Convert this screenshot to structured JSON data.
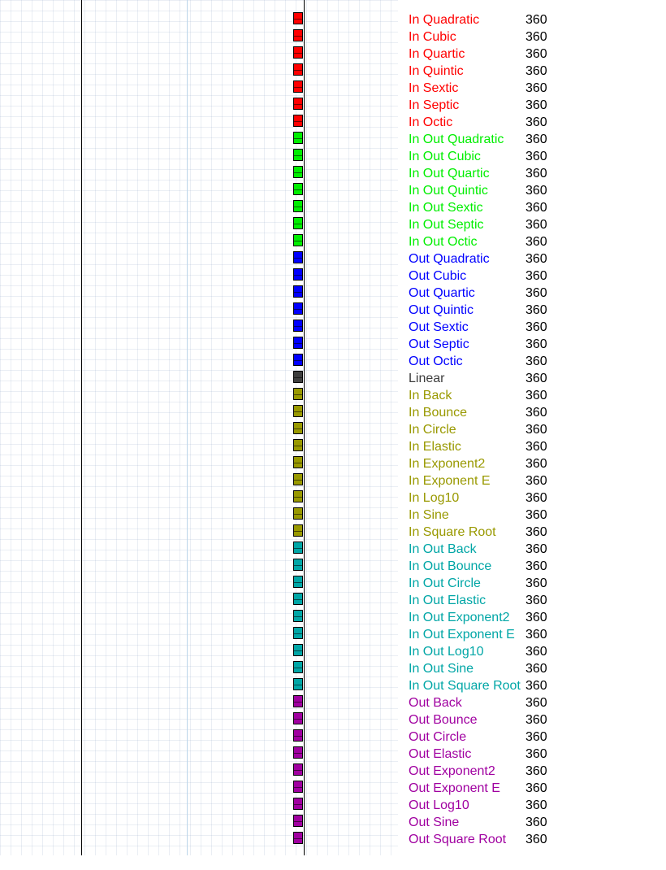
{
  "colors": {
    "in": "#ff0000",
    "in_out": "#00ee00",
    "out": "#0000ff",
    "linear": "#3d3d3d",
    "in_special": "#999900",
    "in_out_special": "#00a6a6",
    "out_special": "#a000a0"
  },
  "easings": [
    {
      "label": "In Quadratic",
      "value": "360",
      "group": "in"
    },
    {
      "label": "In Cubic",
      "value": "360",
      "group": "in"
    },
    {
      "label": "In Quartic",
      "value": "360",
      "group": "in"
    },
    {
      "label": "In Quintic",
      "value": "360",
      "group": "in"
    },
    {
      "label": "In Sextic",
      "value": "360",
      "group": "in"
    },
    {
      "label": "In Septic",
      "value": "360",
      "group": "in"
    },
    {
      "label": "In Octic",
      "value": "360",
      "group": "in"
    },
    {
      "label": "In Out Quadratic",
      "value": "360",
      "group": "in_out"
    },
    {
      "label": "In Out Cubic",
      "value": "360",
      "group": "in_out"
    },
    {
      "label": "In Out Quartic",
      "value": "360",
      "group": "in_out"
    },
    {
      "label": "In Out Quintic",
      "value": "360",
      "group": "in_out"
    },
    {
      "label": "In Out Sextic",
      "value": "360",
      "group": "in_out"
    },
    {
      "label": "In Out Septic",
      "value": "360",
      "group": "in_out"
    },
    {
      "label": "In Out Octic",
      "value": "360",
      "group": "in_out"
    },
    {
      "label": "Out Quadratic",
      "value": "360",
      "group": "out"
    },
    {
      "label": "Out Cubic",
      "value": "360",
      "group": "out"
    },
    {
      "label": "Out Quartic",
      "value": "360",
      "group": "out"
    },
    {
      "label": "Out Quintic",
      "value": "360",
      "group": "out"
    },
    {
      "label": "Out Sextic",
      "value": "360",
      "group": "out"
    },
    {
      "label": "Out Septic",
      "value": "360",
      "group": "out"
    },
    {
      "label": "Out Octic",
      "value": "360",
      "group": "out"
    },
    {
      "label": "Linear",
      "value": "360",
      "group": "linear"
    },
    {
      "label": "In Back",
      "value": "360",
      "group": "in_special"
    },
    {
      "label": "In Bounce",
      "value": "360",
      "group": "in_special"
    },
    {
      "label": "In Circle",
      "value": "360",
      "group": "in_special"
    },
    {
      "label": "In Elastic",
      "value": "360",
      "group": "in_special"
    },
    {
      "label": "In Exponent2",
      "value": "360",
      "group": "in_special"
    },
    {
      "label": "In Exponent E",
      "value": "360",
      "group": "in_special"
    },
    {
      "label": "In Log10",
      "value": "360",
      "group": "in_special"
    },
    {
      "label": "In Sine",
      "value": "360",
      "group": "in_special"
    },
    {
      "label": "In Square Root",
      "value": "360",
      "group": "in_special"
    },
    {
      "label": "In Out Back",
      "value": "360",
      "group": "in_out_special"
    },
    {
      "label": "In Out Bounce",
      "value": "360",
      "group": "in_out_special"
    },
    {
      "label": "In Out Circle",
      "value": "360",
      "group": "in_out_special"
    },
    {
      "label": "In Out Elastic",
      "value": "360",
      "group": "in_out_special"
    },
    {
      "label": "In Out Exponent2",
      "value": "360",
      "group": "in_out_special"
    },
    {
      "label": "In Out Exponent E",
      "value": "360",
      "group": "in_out_special"
    },
    {
      "label": "In Out Log10",
      "value": "360",
      "group": "in_out_special"
    },
    {
      "label": "In Out Sine",
      "value": "360",
      "group": "in_out_special"
    },
    {
      "label": "In Out Square Root",
      "value": "360",
      "group": "in_out_special"
    },
    {
      "label": "Out Back",
      "value": "360",
      "group": "out_special"
    },
    {
      "label": "Out Bounce",
      "value": "360",
      "group": "out_special"
    },
    {
      "label": "Out Circle",
      "value": "360",
      "group": "out_special"
    },
    {
      "label": "Out Elastic",
      "value": "360",
      "group": "out_special"
    },
    {
      "label": "Out Exponent2",
      "value": "360",
      "group": "out_special"
    },
    {
      "label": "Out Exponent E",
      "value": "360",
      "group": "out_special"
    },
    {
      "label": "Out Log10",
      "value": "360",
      "group": "out_special"
    },
    {
      "label": "Out Sine",
      "value": "360",
      "group": "out_special"
    },
    {
      "label": "Out Square Root",
      "value": "360",
      "group": "out_special"
    }
  ]
}
